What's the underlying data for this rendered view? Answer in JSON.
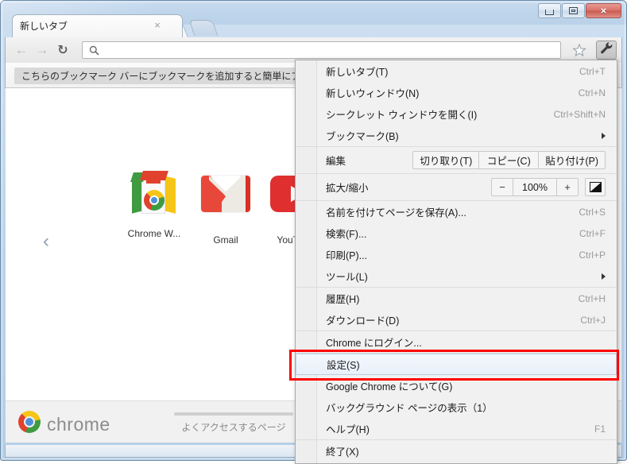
{
  "window": {
    "controls": {
      "minimize_label": "Minimize",
      "maximize_label": "Restore",
      "close_label": "×"
    }
  },
  "tabstrip": {
    "tab_title": "新しいタブ",
    "tab_close_label": "×",
    "new_tab_label": "New tab"
  },
  "toolbar": {
    "back_label": "←",
    "forward_label": "→",
    "reload_label": "↻",
    "omnibox_value": "",
    "omnibox_placeholder": ""
  },
  "bookmark_bar": {
    "hint_text": "こちらのブックマーク バーにブックマークを追加すると簡単にアクセスできます。"
  },
  "new_tab_page": {
    "prev_arrow": "‹",
    "tiles": [
      {
        "label": "Chrome W...",
        "icon": "chrome-web-store-icon"
      },
      {
        "label": "Gmail",
        "icon": "gmail-icon"
      },
      {
        "label": "YouTube",
        "icon": "youtube-icon"
      }
    ],
    "footer": {
      "brand": "chrome",
      "most_visited_label": "よくアクセスするページ"
    }
  },
  "menu": {
    "groups": [
      {
        "items": [
          {
            "label": "新しいタブ(T)",
            "accel": "Ctrl+T",
            "type": "item"
          },
          {
            "label": "新しいウィンドウ(N)",
            "accel": "Ctrl+N",
            "type": "item"
          },
          {
            "label": "シークレット ウィンドウを開く(I)",
            "accel": "Ctrl+Shift+N",
            "type": "item"
          },
          {
            "label": "ブックマーク(B)",
            "accel": "",
            "type": "submenu"
          }
        ]
      },
      {
        "items": [
          {
            "label": "編集",
            "type": "edit",
            "buttons": [
              "切り取り(T)",
              "コピー(C)",
              "貼り付け(P)"
            ]
          }
        ]
      },
      {
        "items": [
          {
            "label": "拡大/縮小",
            "type": "zoom",
            "minus": "−",
            "value": "100%",
            "plus": "+",
            "fullscreen_icon": "fullscreen-icon"
          }
        ]
      },
      {
        "items": [
          {
            "label": "名前を付けてページを保存(A)...",
            "accel": "Ctrl+S",
            "type": "item"
          },
          {
            "label": "検索(F)...",
            "accel": "Ctrl+F",
            "type": "item"
          },
          {
            "label": "印刷(P)...",
            "accel": "Ctrl+P",
            "type": "item"
          },
          {
            "label": "ツール(L)",
            "accel": "",
            "type": "submenu"
          }
        ]
      },
      {
        "items": [
          {
            "label": "履歴(H)",
            "accel": "Ctrl+H",
            "type": "item"
          },
          {
            "label": "ダウンロード(D)",
            "accel": "Ctrl+J",
            "type": "item"
          }
        ]
      },
      {
        "items": [
          {
            "label": "Chrome にログイン...",
            "accel": "",
            "type": "item"
          }
        ]
      },
      {
        "items": [
          {
            "label": "設定(S)",
            "accel": "",
            "type": "item",
            "selected": true,
            "highlight": true
          },
          {
            "label": "Google Chrome について(G)",
            "accel": "",
            "type": "item"
          },
          {
            "label": "バックグラウンド ページの表示（1）",
            "accel": "",
            "type": "item"
          },
          {
            "label": "ヘルプ(H)",
            "accel": "F1",
            "type": "item"
          }
        ]
      },
      {
        "items": [
          {
            "label": "終了(X)",
            "accel": "",
            "type": "item"
          }
        ]
      }
    ]
  },
  "colors": {
    "highlight_red": "#ff0000",
    "selected_row": "#e8f0fa",
    "menu_bg": "#f1f1f1",
    "titlebar": "#bdd4ea",
    "close_button": "#d8736b"
  }
}
